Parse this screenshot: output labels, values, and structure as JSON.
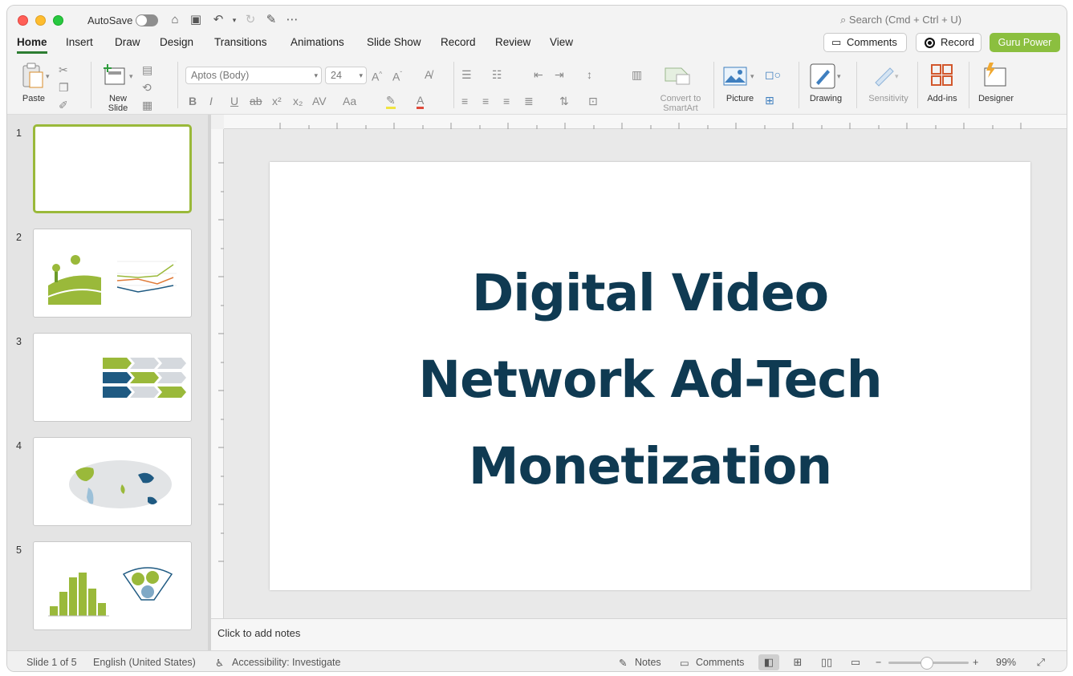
{
  "titlebar": {
    "autosave_label": "AutoSave",
    "search_placeholder": "Search (Cmd + Ctrl + U)"
  },
  "tabs": [
    {
      "label": "Home",
      "active": true
    },
    {
      "label": "Insert"
    },
    {
      "label": "Draw"
    },
    {
      "label": "Design"
    },
    {
      "label": "Transitions"
    },
    {
      "label": "Animations"
    },
    {
      "label": "Slide Show"
    },
    {
      "label": "Record"
    },
    {
      "label": "Review"
    },
    {
      "label": "View"
    }
  ],
  "tab_actions": {
    "comments_label": "Comments",
    "record_label": "Record",
    "guru_label": "Guru Power"
  },
  "ribbon": {
    "paste_label": "Paste",
    "new_slide_label": "New\nSlide",
    "font_name": "Aptos (Body)",
    "font_size": "24",
    "convert_smartart_label": "Convert to\nSmartArt",
    "picture_label": "Picture",
    "drawing_label": "Drawing",
    "sensitivity_label": "Sensitivity",
    "addins_label": "Add-ins",
    "designer_label": "Designer"
  },
  "thumbnails": [
    {
      "number": "1",
      "selected": true
    },
    {
      "number": "2"
    },
    {
      "number": "3"
    },
    {
      "number": "4"
    },
    {
      "number": "5"
    }
  ],
  "slide": {
    "title_line1": "Digital Video",
    "title_line2": "Network Ad-Tech",
    "title_line3": "Monetization"
  },
  "notes": {
    "placeholder": "Click to add notes"
  },
  "status": {
    "slide_indicator": "Slide 1 of 5",
    "language": "English (United States)",
    "accessibility": "Accessibility: Investigate",
    "notes_label": "Notes",
    "comments_label": "Comments",
    "zoom": "99%"
  },
  "colors": {
    "accent_green": "#8bbf3f",
    "title_navy": "#0f3a52",
    "selected_border": "#9ab93a"
  }
}
